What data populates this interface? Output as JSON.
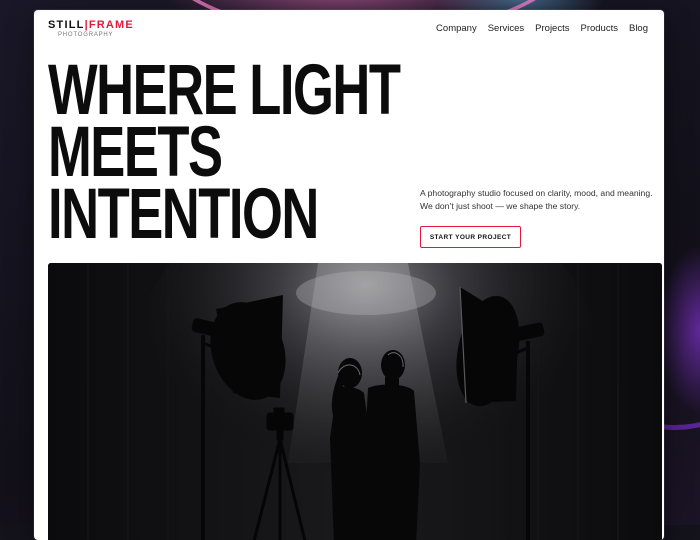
{
  "brand": {
    "name_left": "STILL",
    "name_right": "FRAME",
    "subtitle": "PHOTOGRAPHY",
    "accent_color": "#e0193f"
  },
  "nav": {
    "items": [
      {
        "label": "Company"
      },
      {
        "label": "Services"
      },
      {
        "label": "Projects"
      },
      {
        "label": "Products"
      },
      {
        "label": "Blog"
      }
    ]
  },
  "hero": {
    "title_lines": [
      "WHERE LIGHT",
      "MEETS",
      "INTENTION"
    ],
    "tagline_lines": [
      "A photography studio focused on clarity, mood, and meaning.",
      "We don’t just shoot — we shape the story."
    ],
    "cta_label": "START YOUR PROJECT",
    "image": {
      "description_icon": "studio-photo-icon",
      "subject": "silhouetted couple under spotlight with softbox lights and camera on tripod"
    }
  }
}
